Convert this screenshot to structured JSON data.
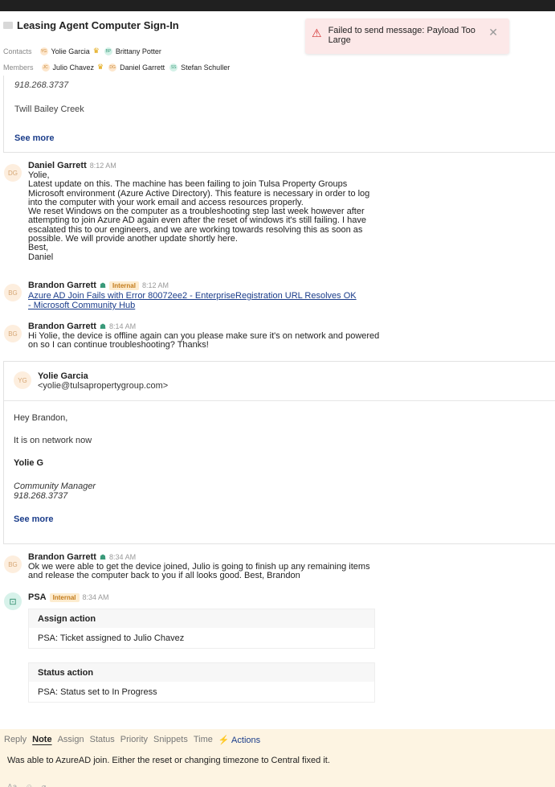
{
  "header": {
    "title": "Leasing Agent Computer Sign-In",
    "contacts_label": "Contacts",
    "members_label": "Members",
    "contacts": [
      {
        "initials": "YG",
        "name": "Yolie Garcia",
        "crown": true,
        "color": "orange"
      },
      {
        "initials": "BP",
        "name": "Brittany Potter",
        "crown": false,
        "color": "green"
      }
    ],
    "members": [
      {
        "initials": "JC",
        "name": "Julio Chavez",
        "crown": true,
        "color": "orange"
      },
      {
        "initials": "DG",
        "name": "Daniel Garrett",
        "crown": false,
        "color": "orange"
      },
      {
        "initials": "SS",
        "name": "Stefan Schuller",
        "crown": false,
        "color": "green"
      }
    ]
  },
  "toast": {
    "message": "Failed to send message: Payload Too Large"
  },
  "email_top": {
    "phone": "918.268.3737",
    "location": "Twill Bailey Creek",
    "see_more": "See more"
  },
  "messages": {
    "m1": {
      "initials": "DG",
      "author": "Daniel Garrett",
      "time": "8:12 AM",
      "text": "Yolie,\nLatest update on this. The machine has been failing to join Tulsa Property Groups\nMicrosoft environment (Azure Active Directory). This feature is necessary in order to log\ninto the computer with your work email and access resources properly.\nWe reset Windows on the computer as a troubleshooting step last week however after\nattempting to join Azure AD again even after the reset of windows it's still failing. I have\nescalated this to our engineers, and we are working towards resolving this as soon as\npossible. We will provide another update shortly here.\nBest,\nDaniel"
    },
    "m2": {
      "initials": "BG",
      "author": "Brandon Garrett",
      "badge": "Internal",
      "time": "8:12 AM",
      "link_text": "Azure AD Join Fails with Error 80072ee2 - EnterpriseRegistration URL Resolves OK - Microsoft Community Hub"
    },
    "m3": {
      "initials": "BG",
      "author": "Brandon Garrett",
      "time": "8:14 AM",
      "text": "Hi Yolie, the device is offline again can you please make sure it's on network and powered\non so I can continue troubleshooting? Thanks!"
    },
    "m5": {
      "initials": "BG",
      "author": "Brandon Garrett",
      "time": "8:34 AM",
      "text": "Ok we were able to get the device joined, Julio is going to finish up any remaining items\nand release the computer back to you if all looks good. Best, Brandon"
    },
    "m6": {
      "author": "PSA",
      "badge": "Internal",
      "time": "8:34 AM",
      "actions": [
        {
          "title": "Assign action",
          "body": "PSA: Ticket assigned to Julio Chavez"
        },
        {
          "title": "Status action",
          "body": "PSA: Status set to In Progress"
        }
      ]
    }
  },
  "email2": {
    "initials": "YG",
    "name": "Yolie Garcia",
    "address": "<yolie@tulsapropertygroup.com>",
    "greeting": "Hey Brandon,",
    "line": "It is on network now",
    "signature": "Yolie G",
    "role": "Community Manager",
    "phone": "918.268.3737",
    "see_more": "See more"
  },
  "composer": {
    "tabs": [
      "Reply",
      "Note",
      "Assign",
      "Status",
      "Priority",
      "Snippets",
      "Time"
    ],
    "active_tab": "Note",
    "actions_label": "Actions",
    "text": "Was able to AzureAD join. Either the reset or changing timezone to Central fixed it."
  }
}
